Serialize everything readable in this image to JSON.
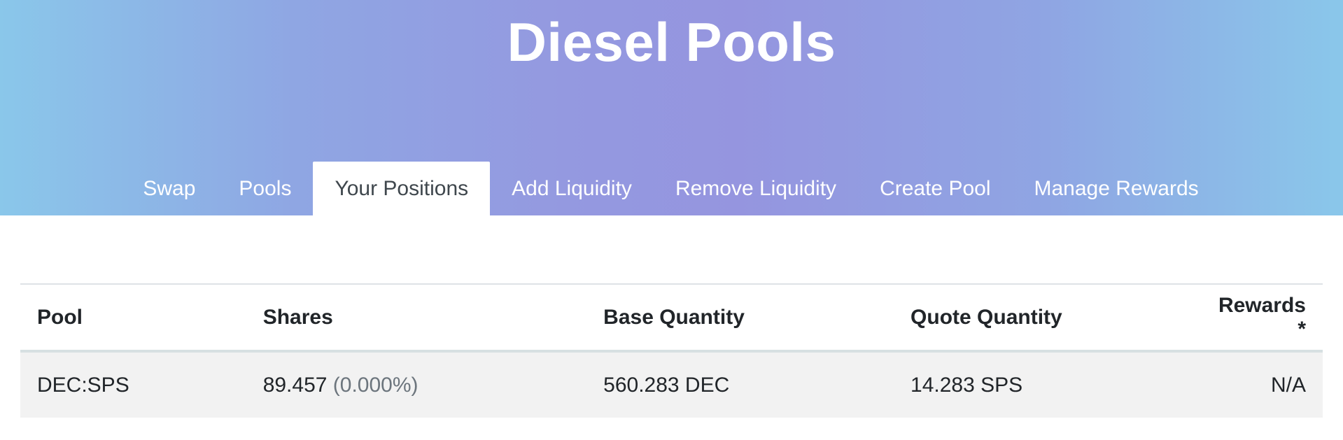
{
  "header": {
    "title": "Diesel Pools",
    "tabs": [
      {
        "label": "Swap",
        "active": false
      },
      {
        "label": "Pools",
        "active": false
      },
      {
        "label": "Your Positions",
        "active": true
      },
      {
        "label": "Add Liquidity",
        "active": false
      },
      {
        "label": "Remove Liquidity",
        "active": false
      },
      {
        "label": "Create Pool",
        "active": false
      },
      {
        "label": "Manage Rewards",
        "active": false
      }
    ]
  },
  "positions": {
    "columns": [
      "Pool",
      "Shares",
      "Base Quantity",
      "Quote Quantity",
      "Rewards *"
    ],
    "rows": [
      {
        "pool": "DEC:SPS",
        "shares": "89.457",
        "share_percent": "(0.000%)",
        "base_quantity": "560.283 DEC",
        "quote_quantity": "14.283 SPS",
        "rewards": "N/A"
      }
    ]
  },
  "colors": {
    "gradient_edge": "#8ac7ea",
    "gradient_center": "#9595df",
    "active_tab_text": "#3f474d",
    "row_background": "#f2f2f2",
    "muted_text": "#6c757d"
  }
}
